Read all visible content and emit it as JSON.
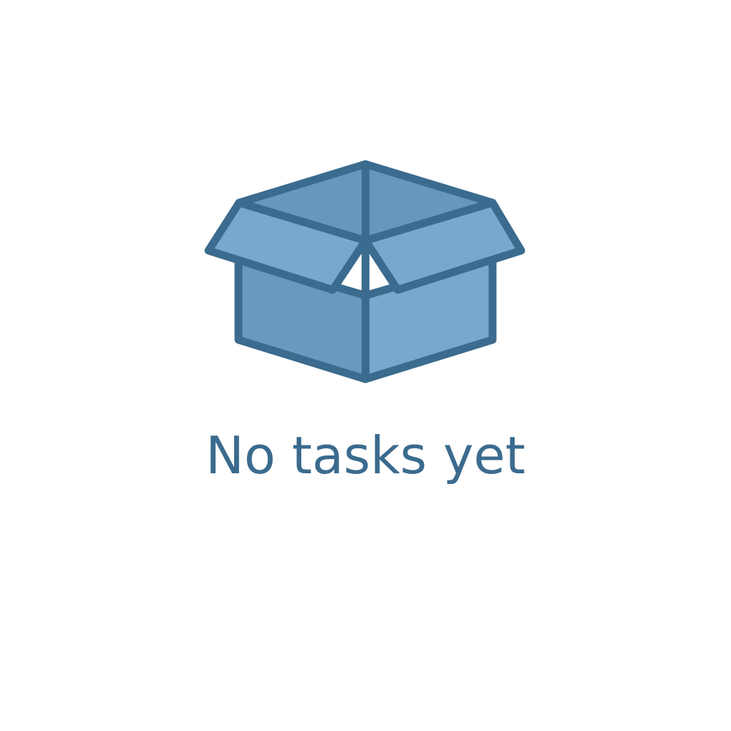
{
  "empty_state": {
    "icon": "open-box-icon",
    "message": "No tasks yet"
  },
  "colors": {
    "background": "#ffffff",
    "stroke": "#3b6b8e",
    "box_fill_front": "#6a99bf",
    "box_fill_side": "#79a8cc",
    "box_fill_inner": "#6698bf",
    "text": "#3b6b8e"
  }
}
